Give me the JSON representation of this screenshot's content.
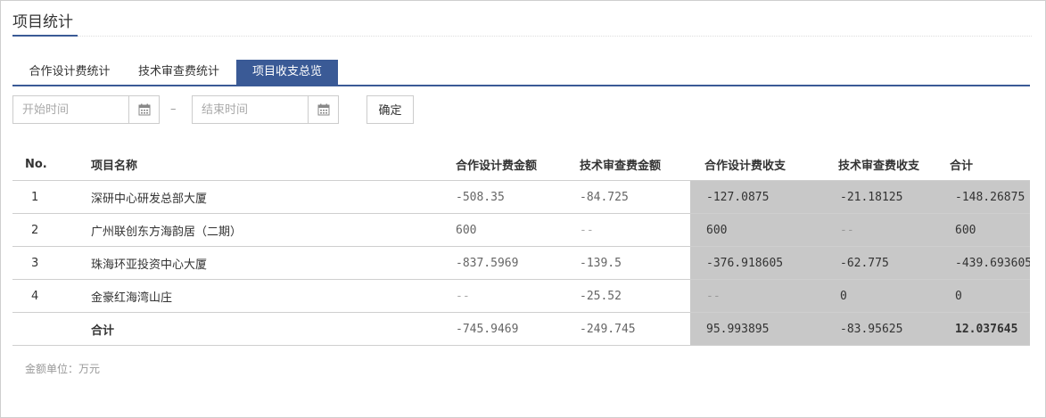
{
  "page": {
    "title": "项目统计"
  },
  "tabs": [
    {
      "label": "合作设计费统计",
      "active": false
    },
    {
      "label": "技术审查费统计",
      "active": false
    },
    {
      "label": "项目收支总览",
      "active": true
    }
  ],
  "filters": {
    "start_placeholder": "开始时间",
    "end_placeholder": "结束时间",
    "separator": "–",
    "confirm_label": "确定"
  },
  "table": {
    "headers": [
      "No.",
      "项目名称",
      "合作设计费金额",
      "技术审查费金额",
      "合作设计费收支",
      "技术审查费收支",
      "合计"
    ],
    "rows": [
      {
        "no": "1",
        "name": "深研中心研发总部大厦",
        "coop_amount": "-508.35",
        "review_amount": "-84.725",
        "coop_balance": "-127.0875",
        "review_balance": "-21.18125",
        "total": "-148.26875"
      },
      {
        "no": "2",
        "name": "广州联创东方海韵居（二期）",
        "coop_amount": "600",
        "review_amount": "--",
        "coop_balance": "600",
        "review_balance": "--",
        "total": "600"
      },
      {
        "no": "3",
        "name": "珠海环亚投资中心大厦",
        "coop_amount": "-837.5969",
        "review_amount": "-139.5",
        "coop_balance": "-376.918605",
        "review_balance": "-62.775",
        "total": "-439.693605"
      },
      {
        "no": "4",
        "name": "金豪红海湾山庄",
        "coop_amount": "--",
        "review_amount": "-25.52",
        "coop_balance": "--",
        "review_balance": "0",
        "total": "0"
      }
    ],
    "summary": {
      "label": "合计",
      "coop_amount": "-745.9469",
      "review_amount": "-249.745",
      "coop_balance": "95.993895",
      "review_balance": "-83.95625",
      "total": "12.037645"
    }
  },
  "note": "金额单位：万元",
  "colors": {
    "accent": "#3a5a96",
    "shade": "#c8c8c8",
    "border": "#cfcfcf"
  }
}
